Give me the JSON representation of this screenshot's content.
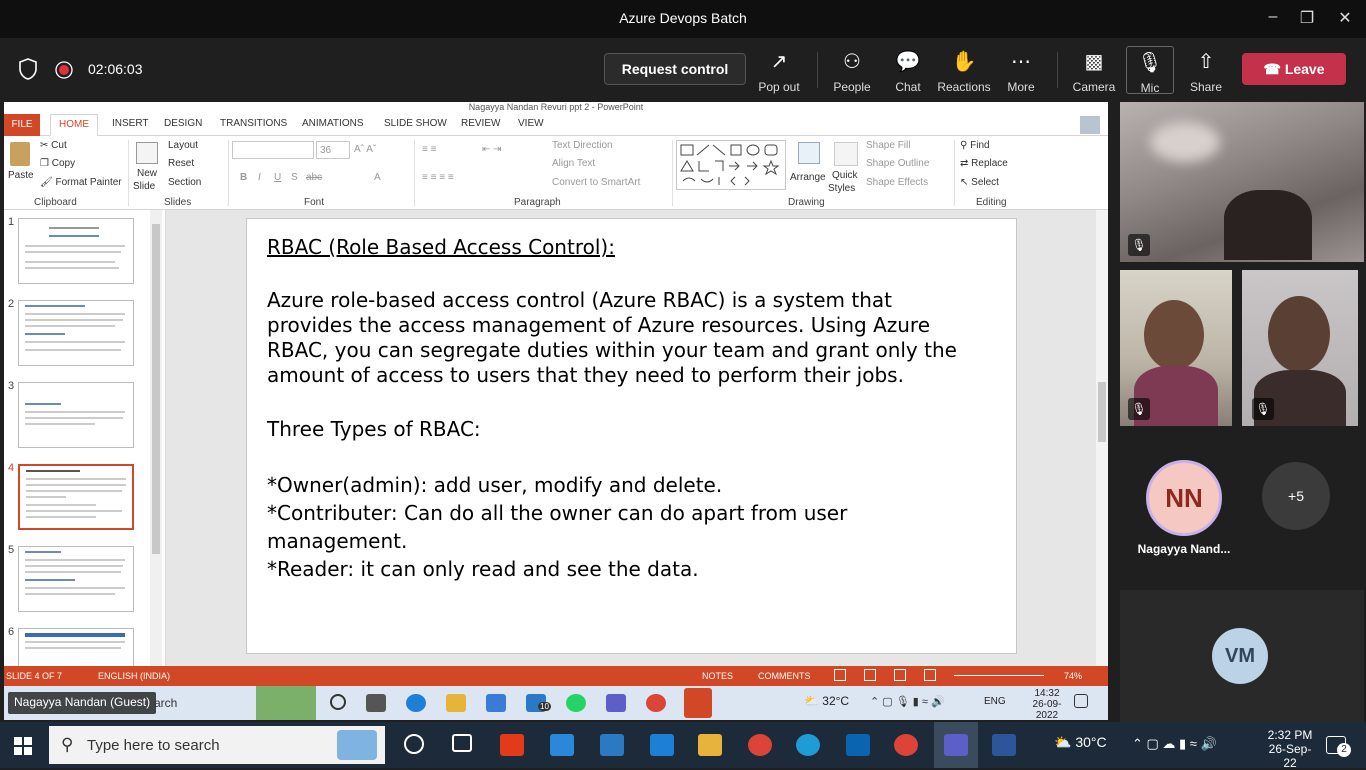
{
  "teams": {
    "window_title": "Azure Devops Batch",
    "timer": "02:06:03",
    "request_control": "Request control",
    "buttons": [
      {
        "label": "Pop out",
        "icon": "pop-out-icon"
      },
      {
        "label": "People",
        "icon": "people-icon"
      },
      {
        "label": "Chat",
        "icon": "chat-icon"
      },
      {
        "label": "Reactions",
        "icon": "reactions-icon"
      },
      {
        "label": "More",
        "icon": "more-icon"
      },
      {
        "label": "Camera",
        "icon": "camera-off-icon"
      },
      {
        "label": "Mic",
        "icon": "mic-off-icon"
      },
      {
        "label": "Share",
        "icon": "share-icon"
      }
    ],
    "leave": "Leave",
    "leave_color": "#c4314b",
    "participants": {
      "nn_initials": "NN",
      "nn_name": "Nagayya Nand...",
      "more_count": "+5",
      "vm_initials": "VM",
      "presenter_label": "Nagayya Nandan (Guest)"
    }
  },
  "ppt": {
    "window_title": "Nagayya Nandan Revuri ppt 2 - PowerPoint",
    "tabs": [
      "FILE",
      "HOME",
      "INSERT",
      "DESIGN",
      "TRANSITIONS",
      "ANIMATIONS",
      "SLIDE SHOW",
      "REVIEW",
      "VIEW"
    ],
    "ribbon": {
      "paste": "Paste",
      "cut": "Cut",
      "copy": "Copy",
      "format_painter": "Format Painter",
      "clipboard": "Clipboard",
      "new_slide": "New",
      "new_slide2": "Slide",
      "layout": "Layout",
      "reset": "Reset",
      "section": "Section",
      "slides": "Slides",
      "font_size": "36",
      "font": "Font",
      "text_direction": "Text Direction",
      "align_text": "Align Text",
      "convert_smartart": "Convert to SmartArt",
      "paragraph": "Paragraph",
      "arrange": "Arrange",
      "quick_styles": "Quick",
      "quick_styles2": "Styles",
      "shape_fill": "Shape Fill",
      "shape_outline": "Shape Outline",
      "shape_effects": "Shape Effects",
      "drawing": "Drawing",
      "find": "Find",
      "replace": "Replace",
      "select": "Select",
      "editing": "Editing"
    },
    "slide_numbers": [
      "1",
      "2",
      "3",
      "4",
      "5",
      "6"
    ],
    "active_slide": 4,
    "slide": {
      "heading": "RBAC (Role Based Access Control):",
      "para_lines": [
        "Azure role-based access control (Azure RBAC) is a system that",
        "provides the access management of Azure resources. Using Azure",
        "RBAC, you can segregate duties within your team and grant only the",
        "amount of access to users that they need to perform their jobs."
      ],
      "types_heading": "Three Types of RBAC:",
      "bullet_lines": [
        "*Owner(admin): add user, modify and delete.",
        "*Contributer: Can do all the owner can do apart from user",
        "management.",
        "*Reader: it can only read and see the data."
      ]
    },
    "status": {
      "slide_of": "SLIDE 4 OF 7",
      "language": "ENGLISH (INDIA)",
      "notes": "NOTES",
      "comments": "COMMENTS",
      "zoom": "74%"
    },
    "accent_color": "#d24726"
  },
  "inner_taskbar": {
    "search_fragment": "arch",
    "weather": "32°C",
    "lang": "ENG",
    "time": "14:32",
    "date": "26-09-2022",
    "mail_badge": "10"
  },
  "taskbar": {
    "search_placeholder": "Type here to search",
    "weather": "30°C",
    "time": "2:32 PM",
    "date": "26-Sep-22",
    "notifications": "2"
  }
}
